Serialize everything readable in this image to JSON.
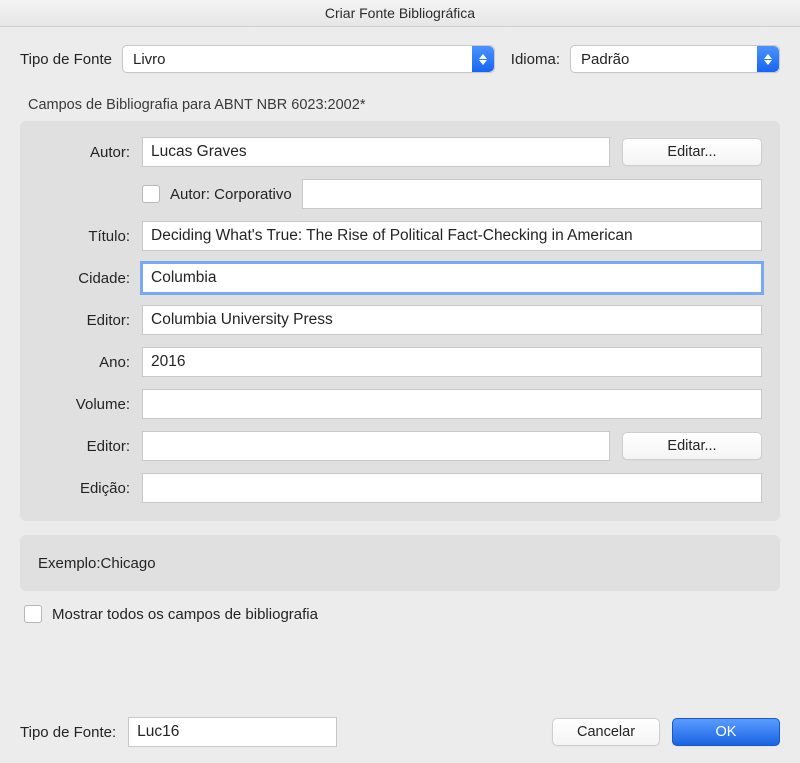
{
  "title": "Criar Fonte Bibliográfica",
  "top": {
    "source_type_label": "Tipo de Fonte",
    "source_type_value": "Livro",
    "language_label": "Idioma:",
    "language_value": "Padrão"
  },
  "section_heading": "Campos de Bibliografia para ABNT NBR 6023:2002*",
  "fields": {
    "author_label": "Autor:",
    "author_value": "Lucas Graves",
    "author_edit": "Editar...",
    "corporate_label": "Autor: Corporativo",
    "corporate_value": "",
    "title_label": "Título:",
    "title_value": "Deciding What's True: The Rise of Political Fact-Checking in American",
    "city_label": "Cidade:",
    "city_value": "Columbia",
    "publisher_label": "Editor:",
    "publisher_value": "Columbia University Press",
    "year_label": "Ano:",
    "year_value": "2016",
    "volume_label": "Volume:",
    "volume_value": "",
    "editor2_label": "Editor:",
    "editor2_value": "",
    "editor2_edit": "Editar...",
    "edition_label": "Edição:",
    "edition_value": ""
  },
  "example": {
    "prefix": "Exemplo: ",
    "value": "Chicago"
  },
  "show_all_label": "Mostrar todos os campos de bibliografia",
  "footer": {
    "tag_label": "Tipo de Fonte:",
    "tag_value": "Luc16",
    "cancel": "Cancelar",
    "ok": "OK"
  }
}
